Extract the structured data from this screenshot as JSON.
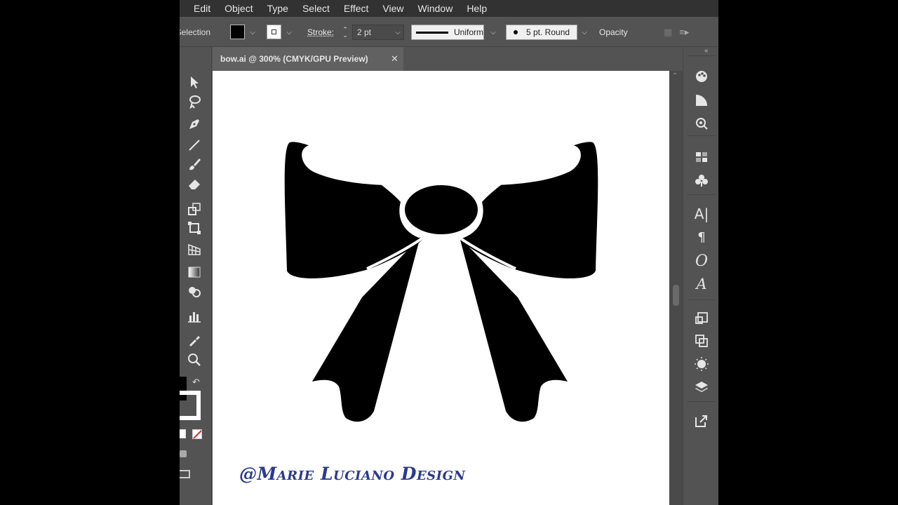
{
  "menubar": {
    "items": [
      "Edit",
      "Object",
      "Type",
      "Select",
      "Effect",
      "View",
      "Window",
      "Help"
    ]
  },
  "controlbar": {
    "selection_label": "Selection",
    "fill_color": "#000000",
    "stroke_color": "#ffffff",
    "stroke_label": "Stroke:",
    "stroke_weight": "2 pt",
    "profile": "Uniform",
    "brush": "5 pt. Round",
    "opacity_label": "Opacity"
  },
  "document": {
    "tab_title": "bow.ai @ 300% (CMYK/GPU Preview)",
    "close_symbol": "✕"
  },
  "canvas": {
    "background": "#ffffff",
    "artwork": "bow",
    "art_color": "#000000",
    "watermark": "@Marie Luciano Design",
    "watermark_color": "#2b3a8c"
  },
  "toolbar": {
    "tools": [
      "selection-tool",
      "lasso-tool",
      "pen-tool",
      "line-tool",
      "paintbrush-tool",
      "eraser-tool",
      "scale-tool",
      "free-transform-tool",
      "perspective-grid-tool",
      "gradient-tool",
      "shape-builder-tool",
      "graph-tool",
      "eyedropper-tool",
      "zoom-tool"
    ]
  },
  "right_panel": {
    "icons": [
      "color-guide-icon",
      "gradient-panel-icon",
      "appearance-icon",
      "swatches-icon",
      "symbols-icon",
      "character-icon",
      "paragraph-icon",
      "opentype-icon",
      "glyphs-icon",
      "transform-icon",
      "pathfinder-icon",
      "brushes-icon",
      "layers-icon",
      "export-icon"
    ],
    "character_glyph": "A|",
    "paragraph_glyph": "¶",
    "opentype_glyph": "O",
    "glyphs_glyph": "A"
  }
}
